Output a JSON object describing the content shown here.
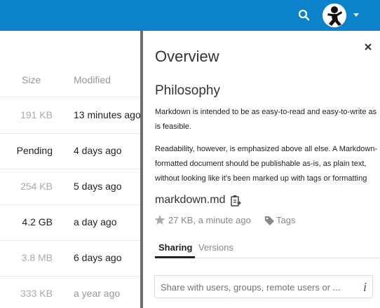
{
  "header": {
    "search_icon": "search-icon",
    "avatar_icon": "avatar-icon",
    "menu_icon": "chevron-down-icon",
    "bar_color": "#0b82c9"
  },
  "file_list": {
    "columns": {
      "size": "Size",
      "modified": "Modified"
    },
    "rows": [
      {
        "size": "191 KB",
        "size_color": "#aaaaaa",
        "modified": "13 minutes ago",
        "modified_color": "#222222"
      },
      {
        "size": "Pending",
        "size_color": "#222222",
        "modified": "4 days ago",
        "modified_color": "#222222"
      },
      {
        "size": "254 KB",
        "size_color": "#aaaaaa",
        "modified": "5 days ago",
        "modified_color": "#222222"
      },
      {
        "size": "4.2 GB",
        "size_color": "#222222",
        "modified": "a day ago",
        "modified_color": "#222222"
      },
      {
        "size": "3.8 MB",
        "size_color": "#aaaaaa",
        "modified": "6 days ago",
        "modified_color": "#222222"
      },
      {
        "size": "333 KB",
        "size_color": "#aaaaaa",
        "modified": "a year ago",
        "modified_color": "#999999"
      }
    ]
  },
  "details": {
    "title": "Overview",
    "heading": "Philosophy",
    "paragraph1": [
      "Markdown is intended to be as easy-to-read and easy-to-write as",
      "is feasible."
    ],
    "paragraph2": [
      "Readability, however, is emphasized above all else. A Markdown-",
      "formatted document should be publishable as-is, as plain text,",
      "without looking like it's been marked up with tags or formatting"
    ],
    "file_name": "markdown.md",
    "meta": "27 KB, a minute ago",
    "tags_label": "Tags",
    "tabs": [
      {
        "label": "Sharing",
        "active": true
      },
      {
        "label": "Versions",
        "active": false
      }
    ],
    "share_placeholder": "Share with users, groups, remote users or ...",
    "info_icon": "i"
  }
}
